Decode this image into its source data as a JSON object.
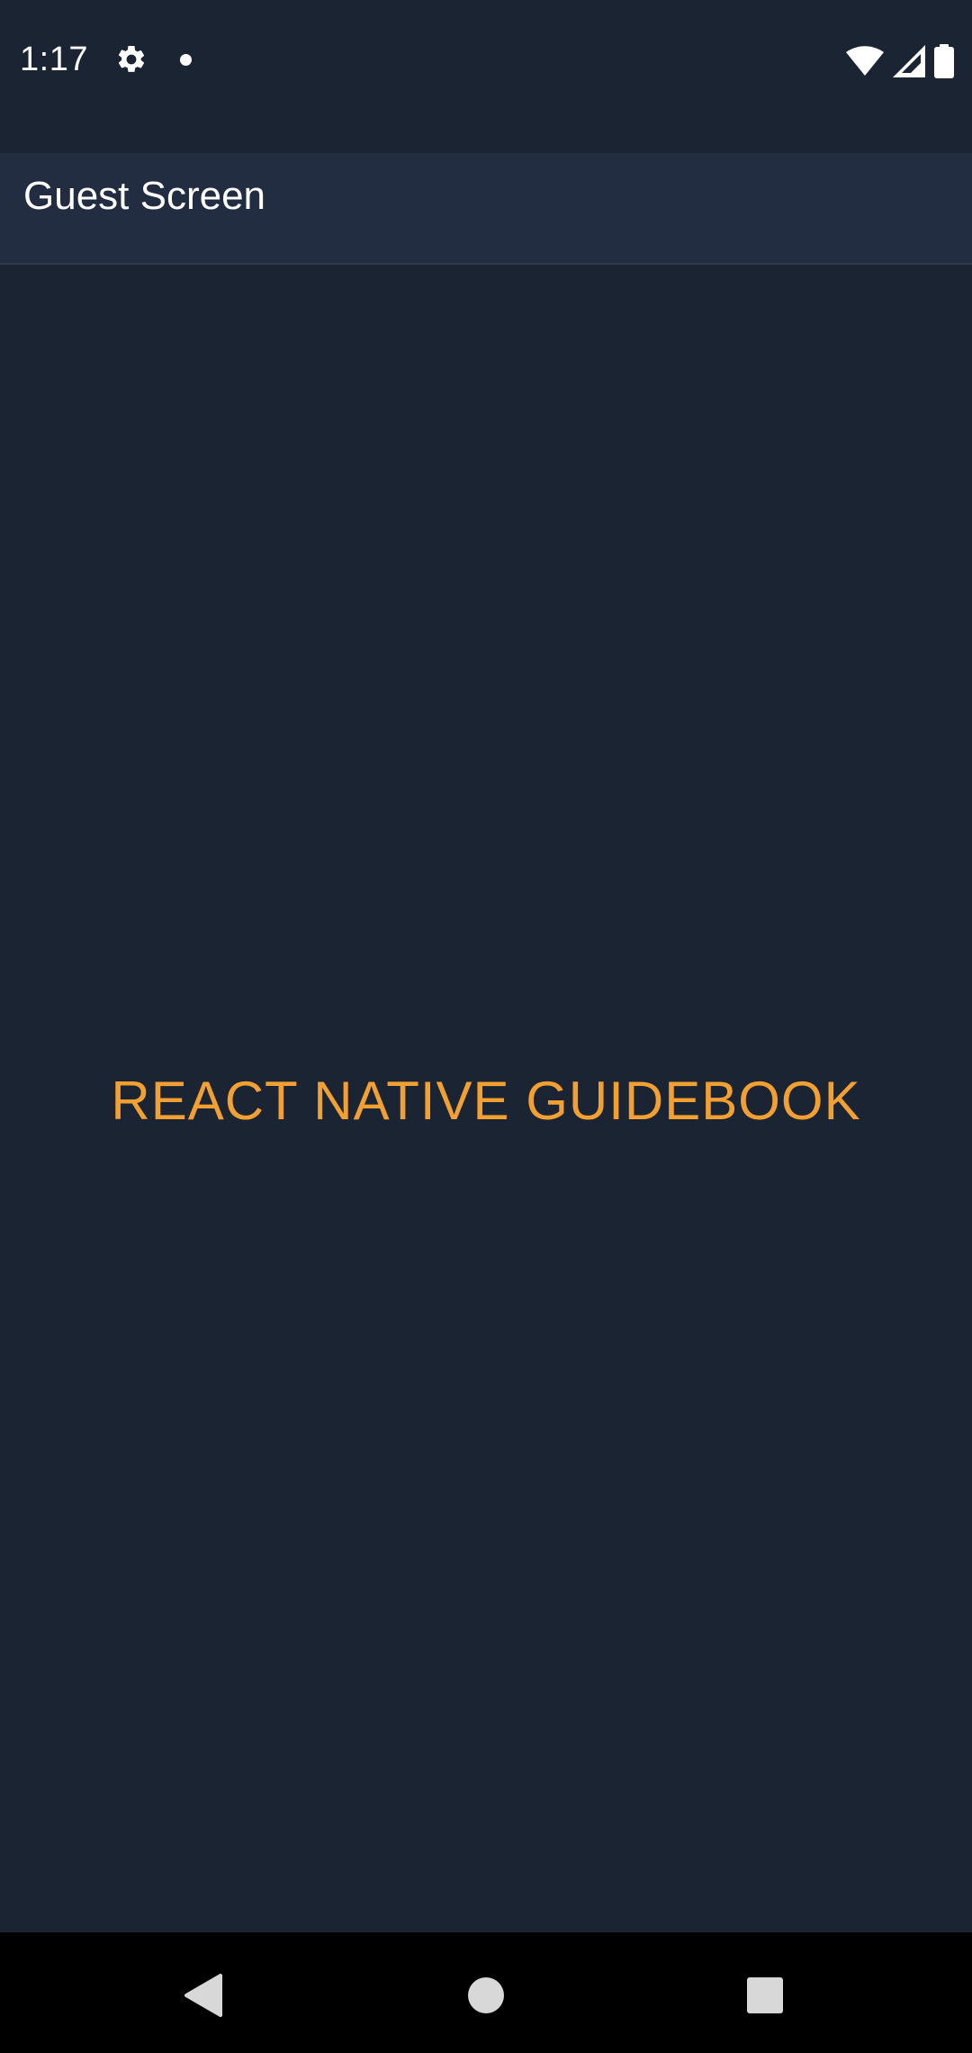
{
  "status_bar": {
    "time": "1:17",
    "icons": [
      "gear-icon",
      "notification-dot-icon",
      "wifi-icon",
      "signal-icon",
      "battery-icon"
    ]
  },
  "header": {
    "title": "Guest Screen"
  },
  "main": {
    "title": "REACT NATIVE GUIDEBOOK"
  },
  "nav_bar": {
    "buttons": [
      "back-icon",
      "home-icon",
      "recents-icon"
    ]
  },
  "colors": {
    "background": "#1b2432",
    "header": "#222d42",
    "accent": "#f2a032",
    "text": "#ffffff",
    "nav": "#000000"
  }
}
